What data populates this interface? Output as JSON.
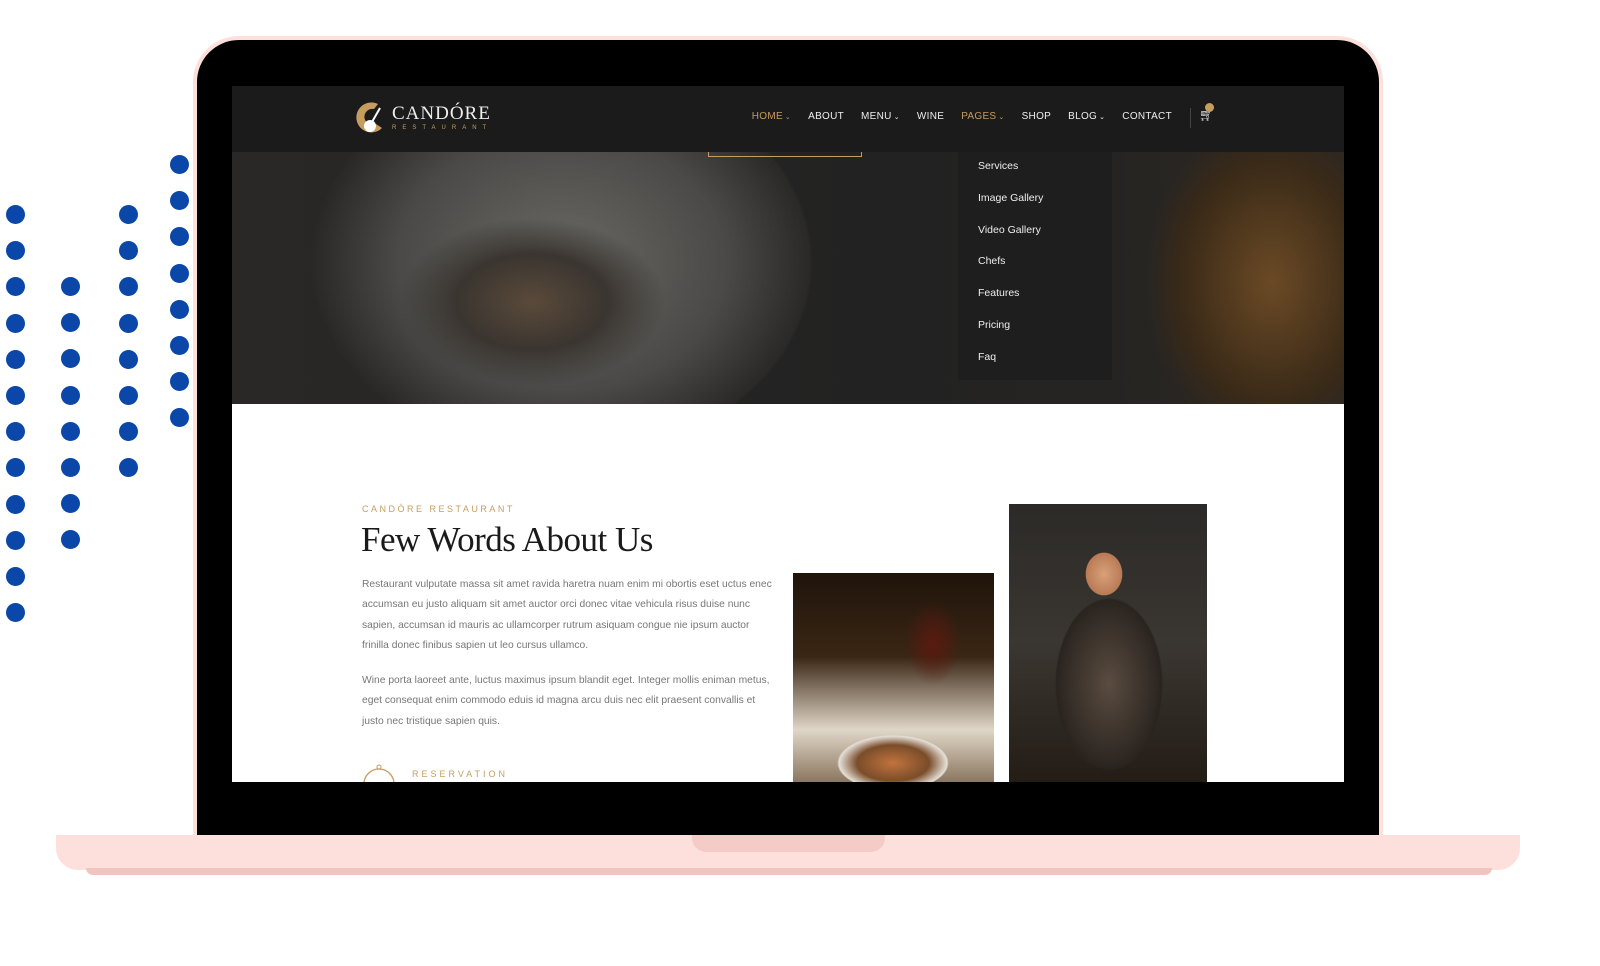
{
  "colors": {
    "accent": "#c59d5f",
    "nav_bg": "#1b1b1b",
    "dots": "#0a47a8",
    "frame": "#fde0dc"
  },
  "logo": {
    "name": "CANDÓRE",
    "sub": "RESTAURANT"
  },
  "nav": {
    "items": [
      {
        "label": "HOME",
        "active": true,
        "dropdown": true
      },
      {
        "label": "ABOUT",
        "active": false,
        "dropdown": false
      },
      {
        "label": "MENU",
        "active": false,
        "dropdown": true
      },
      {
        "label": "WINE",
        "active": false,
        "dropdown": false
      },
      {
        "label": "PAGES",
        "active": true,
        "dropdown": true
      },
      {
        "label": "SHOP",
        "active": false,
        "dropdown": false
      },
      {
        "label": "BLOG",
        "active": false,
        "dropdown": true
      },
      {
        "label": "CONTACT",
        "active": false,
        "dropdown": false
      }
    ],
    "cart_icon": "cart-icon"
  },
  "dropdown": {
    "items": [
      "Services",
      "Image Gallery",
      "Video Gallery",
      "Chefs",
      "Features",
      "Pricing",
      "Faq"
    ]
  },
  "about": {
    "eyebrow": "CANDÓRE RESTAURANT",
    "title": "Few Words About Us",
    "para1": "Restaurant vulputate massa sit amet ravida haretra nuam enim mi obortis eset uctus enec accumsan eu justo aliquam sit amet auctor orci donec vitae vehicula risus duise nunc sapien, accumsan id mauris ac ullamcorper rutrum asiquam congue nie ipsum auctor frinilla donec finibus sapien ut leo cursus ullamco.",
    "para2": "Wine porta laoreet ante, luctus maximus ipsum blandit eget. Integer mollis eniman metus, eget consequat enim commodo eduis id magna arcu duis nec elit praesent convallis et justo nec tristique sapien quis.",
    "reservation": "RESERVATION"
  }
}
